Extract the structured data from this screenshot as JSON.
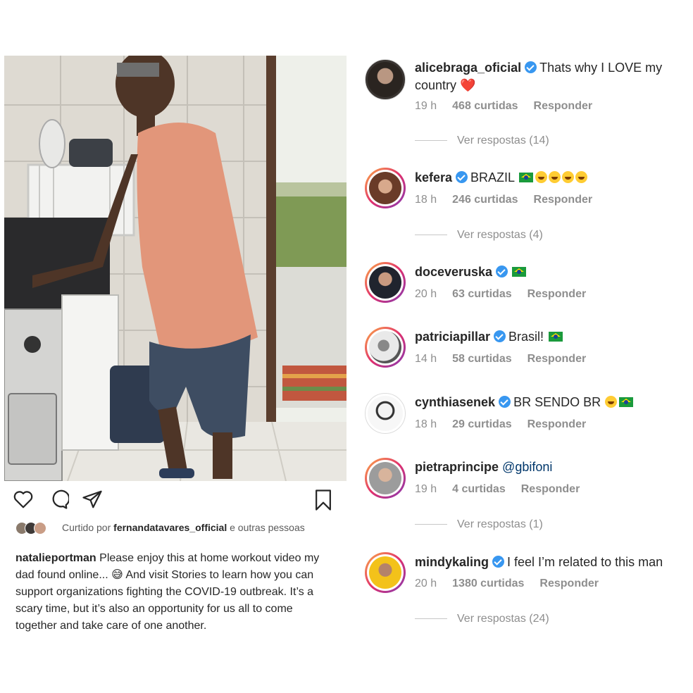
{
  "post": {
    "liked_prefix": "Curtido por",
    "liked_user": "fernandatavares_official",
    "liked_suffix": "e outras pessoas",
    "caption_user": "natalieportman",
    "caption_text": "Please enjoy this at home workout video my dad found online... 😅 And visit Stories to learn how you can support organizations fighting the COVID-19 outbreak. It’s a scary time, but it’s also an opportunity for us all to come together and take care of one another."
  },
  "icons": {
    "like": "heart-outline-icon",
    "comment": "comment-icon",
    "share": "paper-plane-icon",
    "save": "bookmark-icon"
  },
  "comments": [
    {
      "user": "alicebraga_oficial",
      "verified": true,
      "text": "Thats why I LOVE my country",
      "emoji": "❤️",
      "time": "19 h",
      "likes": "468 curtidas",
      "reply": "Responder",
      "view_replies": "Ver respostas (14)"
    },
    {
      "user": "kefera",
      "verified": true,
      "text": "BRAZIL",
      "emoji": "🇧🇷😂😂😂😂",
      "time": "18 h",
      "likes": "246 curtidas",
      "reply": "Responder",
      "view_replies": "Ver respostas (4)"
    },
    {
      "user": "doceveruska",
      "verified": true,
      "text": "",
      "emoji": "🇧🇷",
      "time": "20 h",
      "likes": "63 curtidas",
      "reply": "Responder"
    },
    {
      "user": "patriciapillar",
      "verified": true,
      "text": "Brasil!",
      "emoji": "🇧🇷",
      "time": "14 h",
      "likes": "58 curtidas",
      "reply": "Responder"
    },
    {
      "user": "cynthiasenek",
      "verified": true,
      "text": "BR SENDO BR",
      "emoji": "😂🇧🇷",
      "time": "18 h",
      "likes": "29 curtidas",
      "reply": "Responder"
    },
    {
      "user": "pietraprincipe",
      "verified": false,
      "text": "@gbifoni",
      "time": "19 h",
      "likes": "4 curtidas",
      "reply": "Responder",
      "view_replies": "Ver respostas (1)"
    },
    {
      "user": "mindykaling",
      "verified": true,
      "text": "I feel I’m related to this man",
      "time": "20 h",
      "likes": "1380 curtidas",
      "reply": "Responder",
      "view_replies": "Ver respostas (24)"
    }
  ]
}
